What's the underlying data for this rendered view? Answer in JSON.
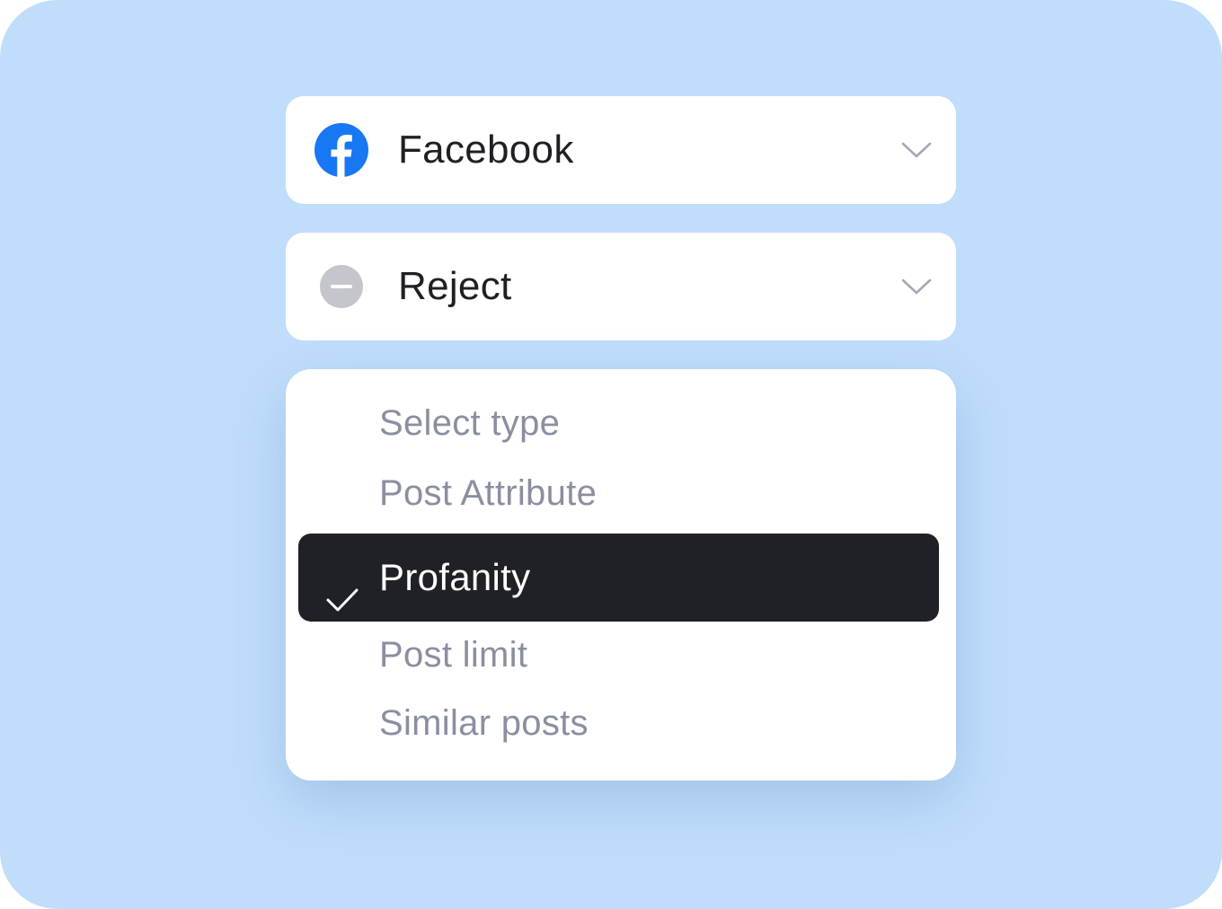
{
  "platform_select": {
    "label": "Facebook",
    "icon": "facebook-icon",
    "icon_color": "#1877f2"
  },
  "action_select": {
    "label": "Reject",
    "icon": "minus-circle-icon",
    "icon_color": "#c5c6cb"
  },
  "type_dropdown": {
    "options": [
      {
        "label": "Select type",
        "selected": false
      },
      {
        "label": "Post Attribute",
        "selected": false
      },
      {
        "label": "Profanity",
        "selected": true
      },
      {
        "label": "Post limit",
        "selected": false
      },
      {
        "label": "Similar posts",
        "selected": false
      }
    ],
    "selected_bg": "#202126"
  },
  "colors": {
    "background": "#c0ddfb",
    "text_primary": "#1f2024",
    "text_muted": "#8a8fa0"
  }
}
